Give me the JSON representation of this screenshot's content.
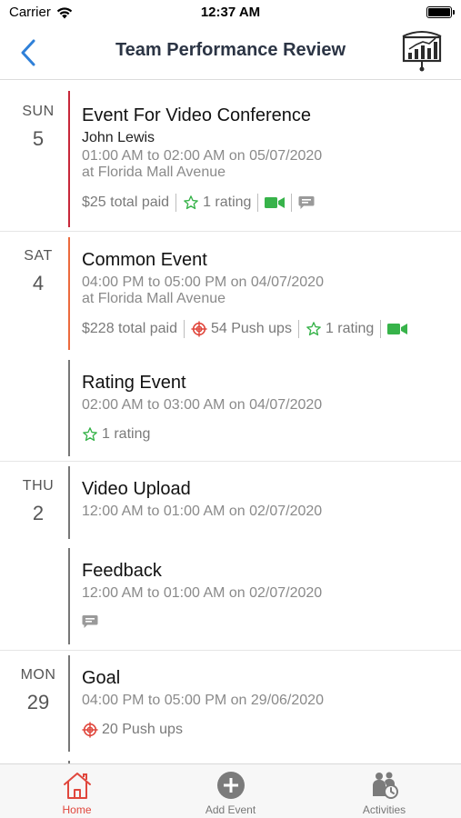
{
  "status_bar": {
    "carrier": "Carrier",
    "time": "12:37 AM"
  },
  "nav": {
    "title": "Team Performance Review",
    "back_icon": "chevron-left-icon",
    "action_icon": "presentation-chart-icon"
  },
  "colors": {
    "accent": "#2f80d8",
    "active_tab": "#e0473d",
    "video": "#37b34a",
    "star": "#37b34a",
    "target": "#e0473d"
  },
  "groups": [
    {
      "dow": "SUN",
      "day": "5",
      "events": [
        {
          "name": "Event For Video Conference",
          "person": "John Lewis",
          "time": "01:00 AM to 02:00 AM on 05/07/2020",
          "location": "at Florida Mall Avenue",
          "paid": "$25 total paid",
          "rating": "1 rating"
        }
      ]
    },
    {
      "dow": "SAT",
      "day": "4",
      "events": [
        {
          "name": "Common Event",
          "time": "04:00 PM to 05:00 PM on 04/07/2020",
          "location": "at Florida Mall Avenue",
          "paid": "$228 total paid",
          "pushups": "54 Push ups",
          "rating": "1 rating"
        },
        {
          "name": "Rating Event",
          "time": "02:00 AM to 03:00 AM on 04/07/2020",
          "rating": "1 rating"
        }
      ]
    },
    {
      "dow": "THU",
      "day": "2",
      "events": [
        {
          "name": "Video Upload",
          "time": "12:00 AM to 01:00 AM on 02/07/2020"
        },
        {
          "name": "Feedback",
          "time": "12:00 AM to 01:00 AM on 02/07/2020"
        }
      ]
    },
    {
      "dow": "MON",
      "day": "29",
      "events": [
        {
          "name": "Goal",
          "time": "04:00 PM to 05:00 PM on 29/06/2020",
          "pushups": "20 Push ups"
        }
      ]
    }
  ],
  "tabs": [
    {
      "label": "Home",
      "icon": "home-icon",
      "active": true
    },
    {
      "label": "Add Event",
      "icon": "add-circle-icon",
      "active": false
    },
    {
      "label": "Activities",
      "icon": "activities-icon",
      "active": false
    }
  ]
}
